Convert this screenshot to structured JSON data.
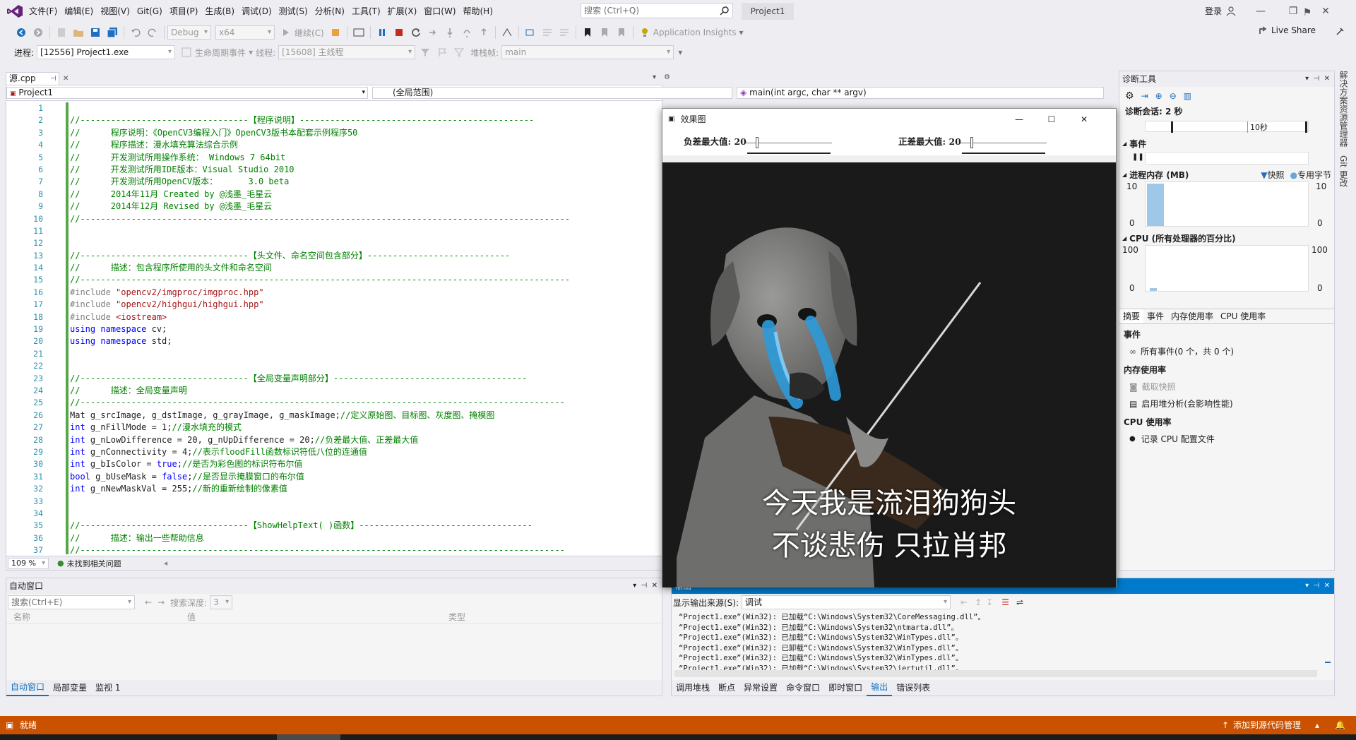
{
  "menubar": {
    "items": [
      "文件(F)",
      "编辑(E)",
      "视图(V)",
      "Git(G)",
      "项目(P)",
      "生成(B)",
      "调试(D)",
      "测试(S)",
      "分析(N)",
      "工具(T)",
      "扩展(X)",
      "窗口(W)",
      "帮助(H)"
    ],
    "search_placeholder": "搜索 (Ctrl+Q)",
    "project_title": "Project1",
    "login": "登录"
  },
  "toolbar": {
    "config": "Debug",
    "platform": "x64",
    "continue": "继续(C)",
    "app_insights": "Application Insights",
    "live_share": "Live Share"
  },
  "debugbar": {
    "process_label": "进程:",
    "process_value": "[12556] Project1.exe",
    "lifecycle_label": "生命周期事件",
    "thread_label": "线程:",
    "thread_value": "[15608] 主线程",
    "stack_label": "堆栈帧:",
    "stack_value": "main"
  },
  "editor": {
    "tab_label": "源.cpp",
    "nav_project": "Project1",
    "nav_scope": "(全局范围)",
    "nav_function": "main(int argc, char ** argv)",
    "zoom": "109 %",
    "issues": "未找到相关问题",
    "lines": [
      {
        "n": "1",
        "html": ""
      },
      {
        "n": "2",
        "html": "<span class='cmt'>//---------------------------------【程序说明】----------------------------------------------</span>"
      },
      {
        "n": "3",
        "html": "<span class='cmt'>//      程序说明：《OpenCV3编程入门》OpenCV3版书本配套示例程序50</span>"
      },
      {
        "n": "4",
        "html": "<span class='cmt'>//      程序描述：漫水填充算法综合示例</span>"
      },
      {
        "n": "5",
        "html": "<span class='cmt'>//      开发测试所用操作系统： Windows 7 64bit</span>"
      },
      {
        "n": "6",
        "html": "<span class='cmt'>//      开发测试所用IDE版本：Visual Studio 2010</span>"
      },
      {
        "n": "7",
        "html": "<span class='cmt'>//      开发测试所用OpenCV版本：      3.0 beta</span>"
      },
      {
        "n": "8",
        "html": "<span class='cmt'>//      2014年11月 Created by @浅墨_毛星云</span>"
      },
      {
        "n": "9",
        "html": "<span class='cmt'>//      2014年12月 Revised by @浅墨_毛星云</span>"
      },
      {
        "n": "10",
        "html": "<span class='cmt'>//------------------------------------------------------------------------------------------------</span>"
      },
      {
        "n": "11",
        "html": ""
      },
      {
        "n": "12",
        "html": ""
      },
      {
        "n": "13",
        "html": "<span class='cmt'>//---------------------------------【头文件、命名空间包含部分】----------------------------</span>"
      },
      {
        "n": "14",
        "html": "<span class='cmt'>//      描述：包含程序所使用的头文件和命名空间</span>"
      },
      {
        "n": "15",
        "html": "<span class='cmt'>//------------------------------------------------------------------------------------------------</span>"
      },
      {
        "n": "16",
        "html": "<span class='pp'>#include </span><span class='str'>\"opencv2/imgproc/imgproc.hpp\"</span>"
      },
      {
        "n": "17",
        "html": "<span class='pp'>#include </span><span class='str'>\"opencv2/highgui/highgui.hpp\"</span>"
      },
      {
        "n": "18",
        "html": "<span class='pp'>#include </span><span class='str'>&lt;iostream&gt;</span>"
      },
      {
        "n": "19",
        "html": "<span class='kw'>using namespace</span> cv;"
      },
      {
        "n": "20",
        "html": "<span class='kw'>using namespace</span> std;"
      },
      {
        "n": "21",
        "html": ""
      },
      {
        "n": "22",
        "html": ""
      },
      {
        "n": "23",
        "html": "<span class='cmt'>//---------------------------------【全局变量声明部分】--------------------------------------</span>"
      },
      {
        "n": "24",
        "html": "<span class='cmt'>//      描述：全局变量声明</span>"
      },
      {
        "n": "25",
        "html": "<span class='cmt'>//-----------------------------------------------------------------------------------------------</span>"
      },
      {
        "n": "26",
        "html": "Mat g_srcImage, g_dstImage, g_grayImage, g_maskImage;<span class='cmt'>//定义原始图、目标图、灰度图、掩模图</span>"
      },
      {
        "n": "27",
        "html": "<span class='kw'>int</span> g_nFillMode = 1;<span class='cmt'>//漫水填充的模式</span>"
      },
      {
        "n": "28",
        "html": "<span class='kw'>int</span> g_nLowDifference = 20, g_nUpDifference = 20;<span class='cmt'>//负差最大值、正差最大值</span>"
      },
      {
        "n": "29",
        "html": "<span class='kw'>int</span> g_nConnectivity = 4;<span class='cmt'>//表示floodFill函数标识符低八位的连通值</span>"
      },
      {
        "n": "30",
        "html": "<span class='kw'>int</span> g_bIsColor = <span class='kw'>true</span>;<span class='cmt'>//是否为彩色图的标识符布尔值</span>"
      },
      {
        "n": "31",
        "html": "<span class='kw'>bool</span> g_bUseMask = <span class='kw'>false</span>;<span class='cmt'>//是否显示掩膜窗口的布尔值</span>"
      },
      {
        "n": "32",
        "html": "<span class='kw'>int</span> g_nNewMaskVal = 255;<span class='cmt'>//新的重新绘制的像素值</span>"
      },
      {
        "n": "33",
        "html": ""
      },
      {
        "n": "34",
        "html": ""
      },
      {
        "n": "35",
        "html": "<span class='cmt'>//---------------------------------【ShowHelpText( )函数】----------------------------------</span>"
      },
      {
        "n": "36",
        "html": "<span class='cmt'>//      描述：输出一些帮助信息</span>"
      },
      {
        "n": "37",
        "html": "<span class='cmt'>//-----------------------------------------------------------------------------------------------</span>"
      }
    ]
  },
  "diag": {
    "title": "诊断工具",
    "session": "诊断会话: 2 秒",
    "timeline_label": "10秒",
    "events_header": "事件",
    "memory_header": "进程内存 (MB)",
    "legend_snapshot": "快照",
    "legend_private": "专用字节",
    "mem_max": "10",
    "mem_min": "0",
    "cpu_header": "CPU (所有处理器的百分比)",
    "cpu_max": "100",
    "cpu_min": "0",
    "tabs": [
      "摘要",
      "事件",
      "内存使用率",
      "CPU 使用率"
    ],
    "section_events": "事件",
    "all_events": "所有事件(0 个，共 0 个)",
    "section_memory": "内存使用率",
    "take_snapshot": "截取快照",
    "heap_profile": "启用堆分析(会影响性能)",
    "section_cpu": "CPU 使用率",
    "record_cpu": "记录 CPU 配置文件"
  },
  "autos": {
    "title": "自动窗口",
    "search_placeholder": "搜索(Ctrl+E)",
    "depth_label": "搜索深度:",
    "depth_value": "3",
    "col_name": "名称",
    "col_value": "值",
    "col_type": "类型",
    "tabs": [
      "自动窗口",
      "局部变量",
      "监视 1"
    ]
  },
  "output": {
    "title": "输出",
    "source_label": "显示输出来源(S):",
    "source_value": "调试",
    "lines": [
      "“Project1.exe”(Win32): 已加载“C:\\Windows\\System32\\CoreMessaging.dll”。",
      "“Project1.exe”(Win32): 已加载“C:\\Windows\\System32\\ntmarta.dll”。",
      "“Project1.exe”(Win32): 已加载“C:\\Windows\\System32\\WinTypes.dll”。",
      "“Project1.exe”(Win32): 已卸载“C:\\Windows\\System32\\WinTypes.dll”。",
      "“Project1.exe”(Win32): 已加载“C:\\Windows\\System32\\WinTypes.dll”。",
      "“Project1.exe”(Win32): 已加载“C:\\Windows\\System32\\iertutil.dll”。"
    ],
    "tabs": [
      "调用堆栈",
      "断点",
      "异常设置",
      "命令窗口",
      "即时窗口",
      "输出",
      "错误列表"
    ]
  },
  "popup": {
    "title": "效果图",
    "low_label": "负差最大值: 20",
    "up_label": "正差最大值: 20",
    "caption1": "今天我是流泪狗狗头",
    "caption2": "不谈悲伤 只拉肖邦"
  },
  "vtabs": [
    "解决方案资源管理器",
    "Git 更改"
  ],
  "statusbar": {
    "ready": "就绪",
    "source_control": "添加到源代码管理"
  },
  "colors": {
    "accent": "#0e70c0",
    "status": "#ca5100",
    "comment": "#008000",
    "keyword": "#0000ff"
  }
}
